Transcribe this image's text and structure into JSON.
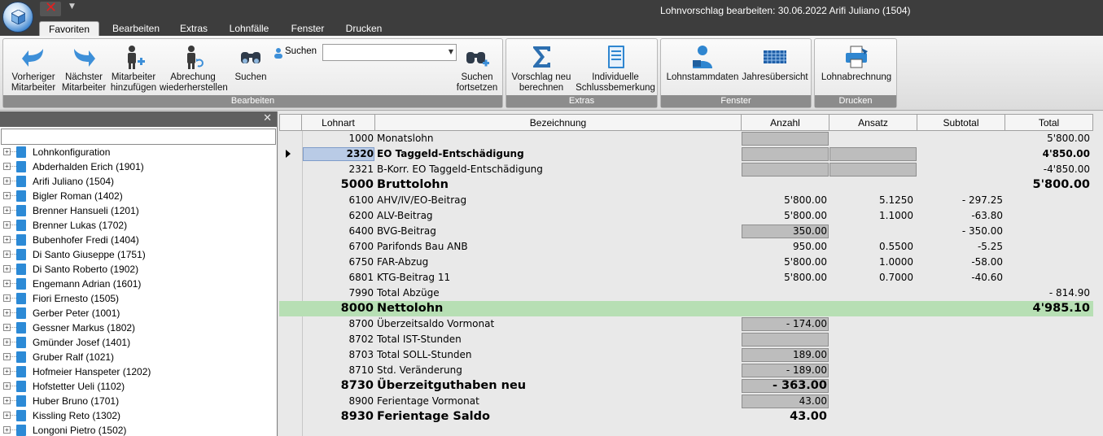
{
  "window": {
    "title": "Lohnvorschlag bearbeiten: 30.06.2022 Arifi Juliano (1504)"
  },
  "tabs": [
    "Favoriten",
    "Bearbeiten",
    "Extras",
    "Lohnfälle",
    "Fenster",
    "Drucken"
  ],
  "active_tab": "Favoriten",
  "ribbon": {
    "groups": {
      "bearbeiten": "Bearbeiten",
      "extras": "Extras",
      "fenster": "Fenster",
      "drucken": "Drucken"
    },
    "buttons": {
      "prev": "Vorheriger\nMitarbeiter",
      "next": "Nächster\nMitarbeiter",
      "add": "Mitarbeiter\nhinzufügen",
      "restore": "Abrechung\nwiederherstellen",
      "search": "Suchen",
      "continue": "Suchen\nfortsetzen",
      "recalc": "Vorschlag neu\nberechnen",
      "remark": "Individuelle\nSchlussbemerkung",
      "master": "Lohnstammdaten",
      "yearly": "Jahresübersicht",
      "payslip": "Lohnabrechnung"
    },
    "search_label": "Suchen",
    "search_value": ""
  },
  "tree": {
    "filter_value": "",
    "items": [
      "Lohnkonfiguration",
      "Abderhalden Erich (1901)",
      "Arifi Juliano (1504)",
      "Bigler Roman (1402)",
      "Brenner Hansueli (1201)",
      "Brenner Lukas (1702)",
      "Bubenhofer Fredi (1404)",
      "Di Santo Giuseppe (1751)",
      "Di Santo Roberto (1902)",
      "Engemann Adrian (1601)",
      "Fiori Ernesto (1505)",
      "Gerber Peter (1001)",
      "Gessner Markus (1802)",
      "Gmünder Josef (1401)",
      "Gruber Ralf (1021)",
      "Hofmeier Hanspeter (1202)",
      "Hofstetter Ueli (1102)",
      "Huber Bruno (1701)",
      "Kissling Reto (1302)",
      "Longoni Pietro (1502)"
    ]
  },
  "grid": {
    "headers": [
      "Lohnart",
      "Bezeichnung",
      "Anzahl",
      "Ansatz",
      "Subtotal",
      "Total"
    ],
    "rows": [
      {
        "code": "1000",
        "name": "Monatslohn",
        "anzahl": "",
        "ansatz": "",
        "subtotal": "",
        "total": "5'800.00"
      },
      {
        "code": "2320",
        "name": "EO Taggeld-Entschädigung",
        "anzahl": "",
        "ansatz": "",
        "subtotal": "",
        "total": "4'850.00"
      },
      {
        "code": "2321",
        "name": "B-Korr. EO Taggeld-Entschädigung",
        "anzahl": "",
        "ansatz": "",
        "subtotal": "",
        "total": "-4'850.00"
      },
      {
        "code": "5000",
        "name": "Bruttolohn",
        "anzahl": "",
        "ansatz": "",
        "subtotal": "",
        "total": "5'800.00"
      },
      {
        "code": "6100",
        "name": "AHV/IV/EO-Beitrag",
        "anzahl": "5'800.00",
        "ansatz": "5.1250",
        "subtotal": "- 297.25",
        "total": ""
      },
      {
        "code": "6200",
        "name": "ALV-Beitrag",
        "anzahl": "5'800.00",
        "ansatz": "1.1000",
        "subtotal": "-63.80",
        "total": ""
      },
      {
        "code": "6400",
        "name": "BVG-Beitrag",
        "anzahl": "350.00",
        "ansatz": "",
        "subtotal": "- 350.00",
        "total": ""
      },
      {
        "code": "6700",
        "name": "Parifonds Bau ANB",
        "anzahl": "950.00",
        "ansatz": "0.5500",
        "subtotal": "-5.25",
        "total": ""
      },
      {
        "code": "6750",
        "name": "FAR-Abzug",
        "anzahl": "5'800.00",
        "ansatz": "1.0000",
        "subtotal": "-58.00",
        "total": ""
      },
      {
        "code": "6801",
        "name": "KTG-Beitrag 11",
        "anzahl": "5'800.00",
        "ansatz": "0.7000",
        "subtotal": "-40.60",
        "total": ""
      },
      {
        "code": "7990",
        "name": "Total Abzüge",
        "anzahl": "",
        "ansatz": "",
        "subtotal": "",
        "total": "- 814.90"
      },
      {
        "code": "8000",
        "name": "Nettolohn",
        "anzahl": "",
        "ansatz": "",
        "subtotal": "",
        "total": "4'985.10"
      },
      {
        "code": "8700",
        "name": "Überzeitsaldo Vormonat",
        "anzahl": "- 174.00",
        "ansatz": "",
        "subtotal": "",
        "total": ""
      },
      {
        "code": "8702",
        "name": "Total IST-Stunden",
        "anzahl": "",
        "ansatz": "",
        "subtotal": "",
        "total": ""
      },
      {
        "code": "8703",
        "name": "Total SOLL-Stunden",
        "anzahl": "189.00",
        "ansatz": "",
        "subtotal": "",
        "total": ""
      },
      {
        "code": "8710",
        "name": "Std. Veränderung",
        "anzahl": "- 189.00",
        "ansatz": "",
        "subtotal": "",
        "total": ""
      },
      {
        "code": "8730",
        "name": "Überzeitguthaben neu",
        "anzahl": "- 363.00",
        "ansatz": "",
        "subtotal": "",
        "total": ""
      },
      {
        "code": "8900",
        "name": "Ferientage Vormonat",
        "anzahl": "43.00",
        "ansatz": "",
        "subtotal": "",
        "total": ""
      },
      {
        "code": "8930",
        "name": "Ferientage Saldo",
        "anzahl": "43.00",
        "ansatz": "",
        "subtotal": "",
        "total": ""
      }
    ]
  },
  "colors": {
    "nettolohn_row": "#b7dfb4",
    "selected_cell": "#b9cbe6",
    "title_bar": "#3d3d3d"
  }
}
